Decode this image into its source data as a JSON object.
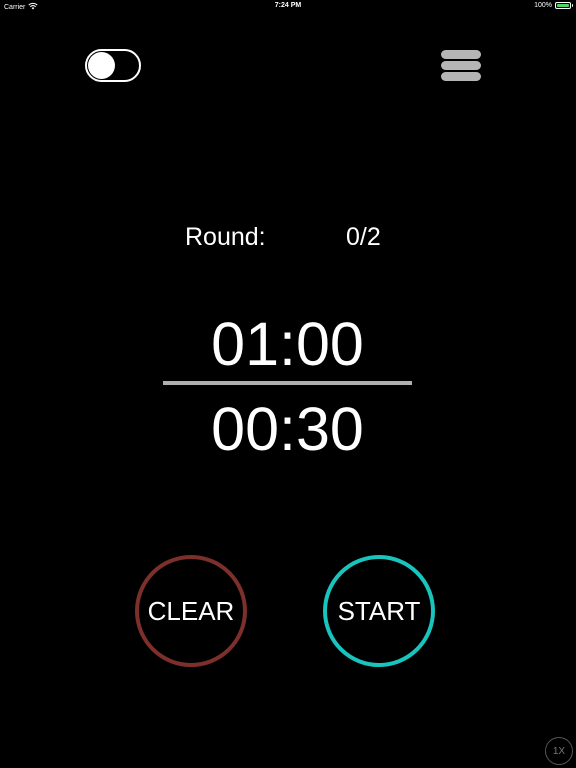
{
  "status_bar": {
    "carrier": "Carrier",
    "time": "7:24 PM",
    "battery_percent": "100%",
    "battery_level": 1.0,
    "icons": [
      "wifi-icon",
      "battery-icon"
    ]
  },
  "header": {
    "toggle_on": false,
    "menu_icon": "hamburger-menu-icon"
  },
  "round": {
    "label": "Round:",
    "value": "0/2"
  },
  "timer": {
    "work_time": "01:00",
    "rest_time": "00:30"
  },
  "buttons": {
    "clear_label": "CLEAR",
    "start_label": "START"
  },
  "speed": {
    "label": "1X"
  },
  "colors": {
    "background": "#000000",
    "clear_ring": "#7d2f2b",
    "start_ring": "#19c4bf",
    "divider": "#b0b0b0",
    "menu_bars": "#b5b5b5"
  }
}
